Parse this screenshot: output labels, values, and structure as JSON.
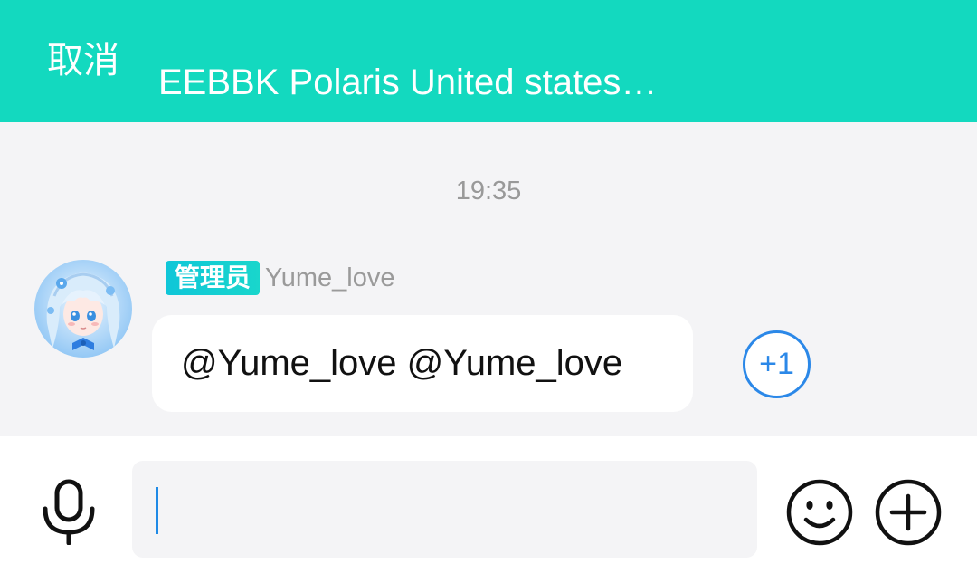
{
  "header": {
    "cancel_label": "取消",
    "title": "EEBBK Polaris United states…",
    "background_color": "#13d9bf"
  },
  "chat": {
    "timestamp": "19:35",
    "messages": [
      {
        "role_badge": "管理员",
        "sender": "Yume_love",
        "text": "@Yume_love @Yume_love",
        "reaction_label": "+1",
        "avatar_icon": "anime-avatar"
      }
    ]
  },
  "input_bar": {
    "input_value": "",
    "mic_icon": "microphone-icon",
    "emoji_icon": "smiley-icon",
    "add_icon": "plus-circle-icon",
    "accent_color": "#1f8ae6"
  }
}
